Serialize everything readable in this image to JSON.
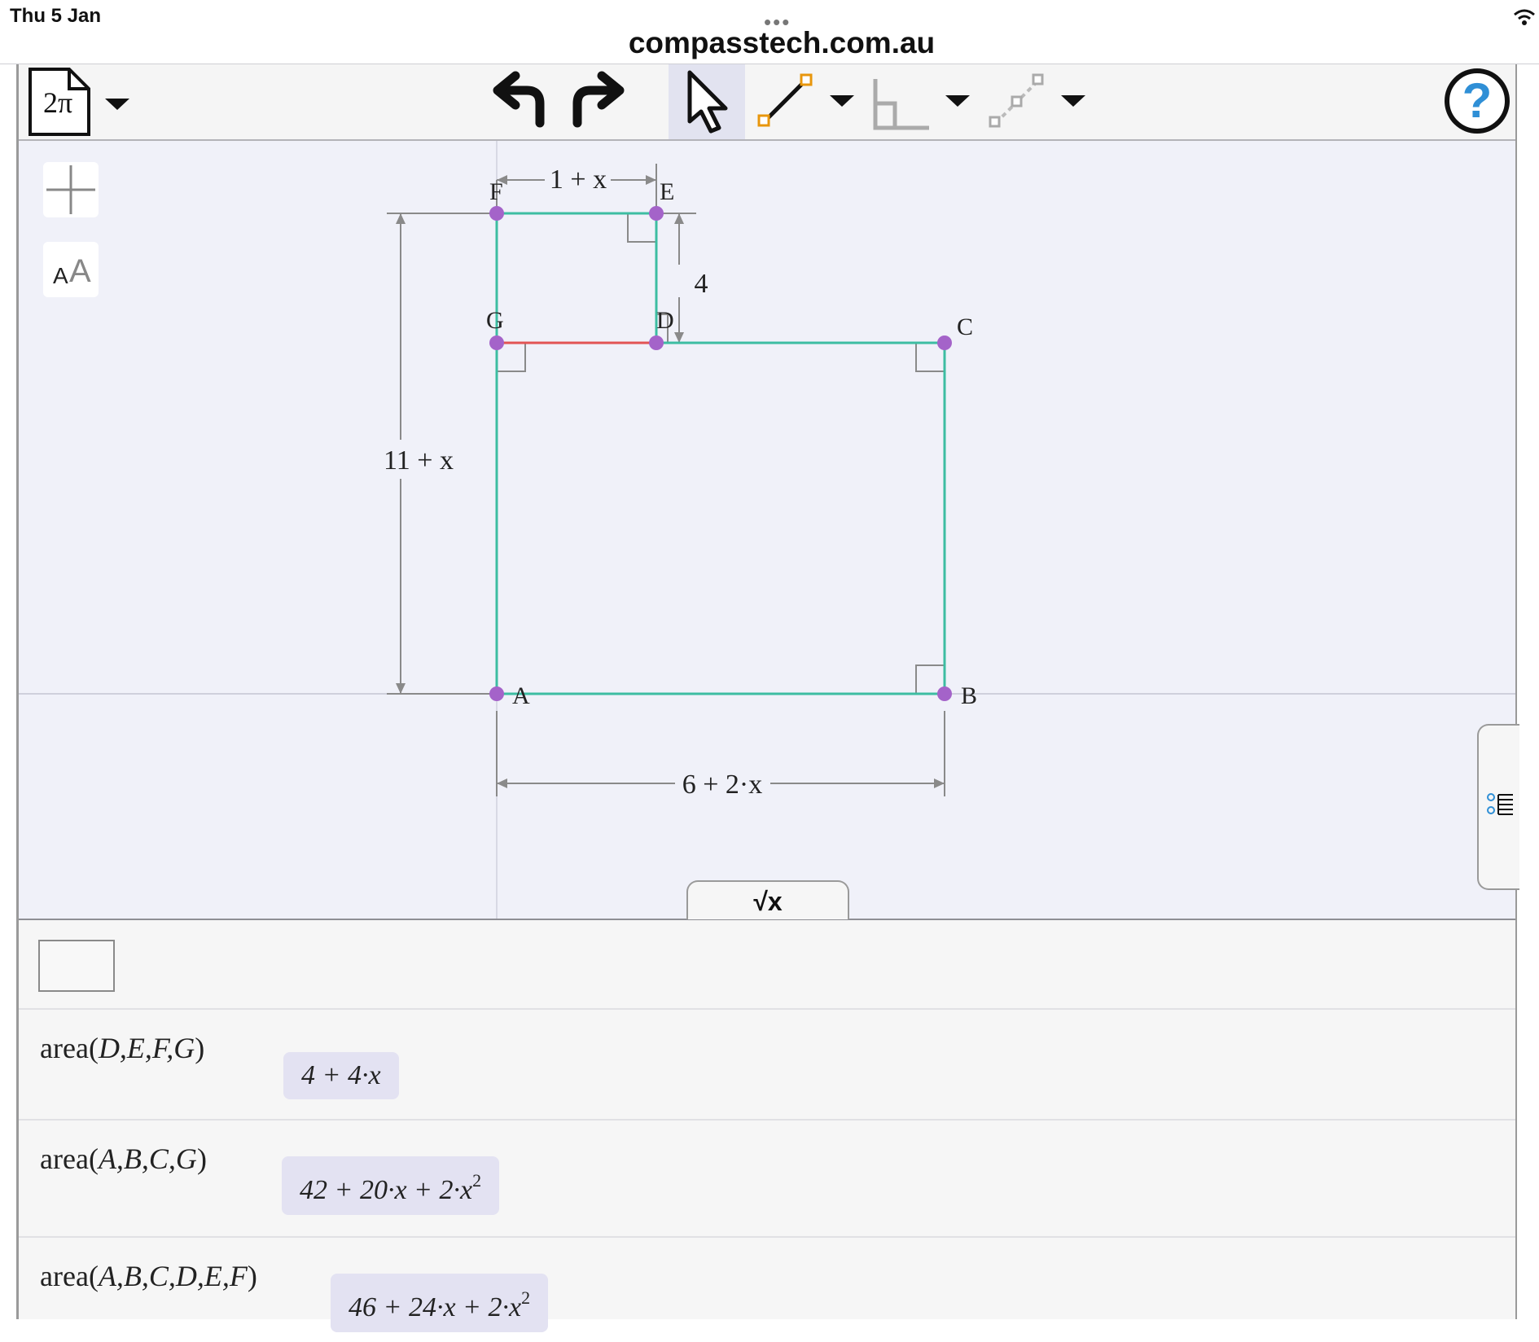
{
  "status": {
    "date": "Thu 5 Jan",
    "more": "•••"
  },
  "browser": {
    "url": "compasstech.com.au"
  },
  "toolbar": {
    "file_label": "2π",
    "help_label": "?"
  },
  "side_tools": {
    "text_size_small": "A",
    "text_size_large": "A"
  },
  "diagram": {
    "points": [
      "A",
      "B",
      "C",
      "D",
      "E",
      "F",
      "G"
    ],
    "dimensions": {
      "top": "1 + x",
      "right_small": "4",
      "left": "11 + x",
      "bottom": "6 + 2·x"
    }
  },
  "math_tab": {
    "label": "√x"
  },
  "cas": {
    "rows": [
      {
        "command_fn": "area",
        "command_args": "D,E,F,G",
        "result": "4 + 4·x",
        "result_power": ""
      },
      {
        "command_fn": "area",
        "command_args": "A,B,C,G",
        "result": "42 + 20·x + 2·x",
        "result_power": "2"
      },
      {
        "command_fn": "area",
        "command_args": "A,B,C,D,E,F",
        "result": "46 + 24·x + 2·x",
        "result_power": "2"
      }
    ]
  },
  "colors": {
    "shape_edge": "#3dbda2",
    "shared_edge": "#e25454",
    "vertex": "#a463c9",
    "dimension": "#8a8a8a",
    "help": "#2f8fd6"
  }
}
